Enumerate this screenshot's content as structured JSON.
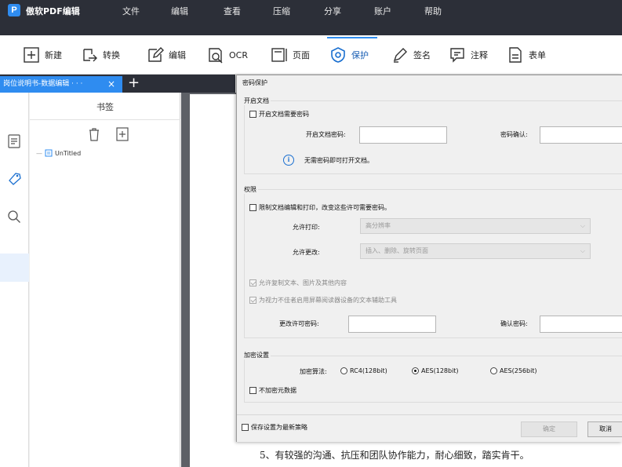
{
  "app": {
    "logo_letter": "P",
    "title": "傲软PDF编辑",
    "menu": [
      "文件",
      "编辑",
      "查看",
      "压缩",
      "分享",
      "账户",
      "帮助"
    ]
  },
  "toolbar": {
    "items": [
      {
        "label": "新建",
        "icon": "plus-box-icon"
      },
      {
        "label": "转换",
        "icon": "convert-icon"
      },
      {
        "label": "编辑",
        "icon": "edit-icon"
      },
      {
        "label": "OCR",
        "icon": "ocr-icon"
      },
      {
        "label": "页面",
        "icon": "page-icon"
      },
      {
        "label": "保护",
        "icon": "shield-icon",
        "active": true
      },
      {
        "label": "签名",
        "icon": "pen-icon"
      },
      {
        "label": "注释",
        "icon": "comment-icon"
      },
      {
        "label": "表单",
        "icon": "form-icon"
      }
    ],
    "accent_color": "#2f8cf0"
  },
  "tabs": {
    "active_title": "岗位说明书-数据编辑 · · ·",
    "close": "×",
    "add": "+"
  },
  "bookmarks": {
    "title": "书签",
    "item": "UnTitled"
  },
  "document": {
    "visible_line": "5、有较强的沟通、抗压和团队协作能力，耐心细致，踏实肯干。"
  },
  "dialog": {
    "title": "密码保护",
    "open_doc": {
      "group": "开启文档",
      "require_checkbox": "开启文档需要密码",
      "password_label": "开启文档密码:",
      "confirm_label": "密码确认:",
      "info": "无需密码即可打开文档。"
    },
    "permissions": {
      "group": "权限",
      "restrict_checkbox": "限制文档编辑和打印，改变这些许可需要密码。",
      "print_label": "允许打印:",
      "print_value": "高分辨率",
      "change_label": "允许更改:",
      "change_value": "插入、删除、旋转页面",
      "copy_checkbox": "允许复制文本、图片及其他内容",
      "accessibility_checkbox": "为视力不佳者启用屏幕阅读器设备的文本辅助工具",
      "perm_password_label": "更改许可密码:",
      "perm_confirm_label": "确认密码:"
    },
    "encryption": {
      "group": "加密设置",
      "algorithm_label": "加密算法:",
      "options": [
        "RC4(128bit)",
        "AES(128bit)",
        "AES(256bit)"
      ],
      "selected": "AES(128bit)",
      "no_metadata_checkbox": "不加密元数据"
    },
    "save_default_checkbox": "保存设置为最新策略",
    "ok": "确定",
    "cancel": "取消"
  }
}
